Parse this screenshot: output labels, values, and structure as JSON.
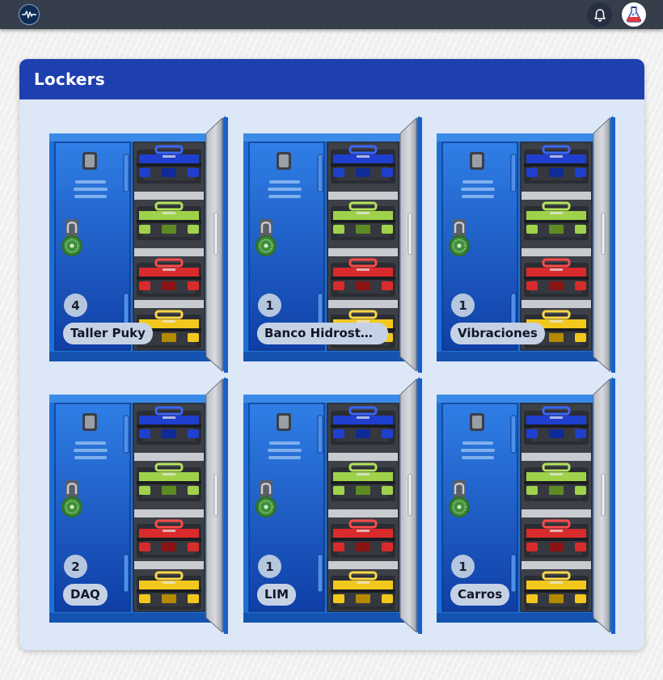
{
  "topbar": {
    "logo_icon": "signal-wave-logo",
    "notification_icon": "bell-icon",
    "avatar_icon": "lab-flask-avatar"
  },
  "page": {
    "title": "Lockers"
  },
  "lockers": [
    {
      "name": "Taller Puky",
      "count": "4"
    },
    {
      "name": "Banco Hidrostát...",
      "count": "1"
    },
    {
      "name": "Vibraciones",
      "count": "1"
    },
    {
      "name": "DAQ",
      "count": "2"
    },
    {
      "name": "LIM",
      "count": "1"
    },
    {
      "name": "Carros",
      "count": "1"
    }
  ],
  "colors": {
    "topbar": "#363d4b",
    "header": "#1e40af",
    "card_bg": "#dce7f7",
    "locker_blue": "#1d6fd8",
    "toolbox_blue": "#1f3fcf",
    "toolbox_lime": "#9fd24a",
    "toolbox_red": "#d92b2b",
    "toolbox_yellow": "#f2c81c",
    "lock_green": "#3f8f3a"
  }
}
